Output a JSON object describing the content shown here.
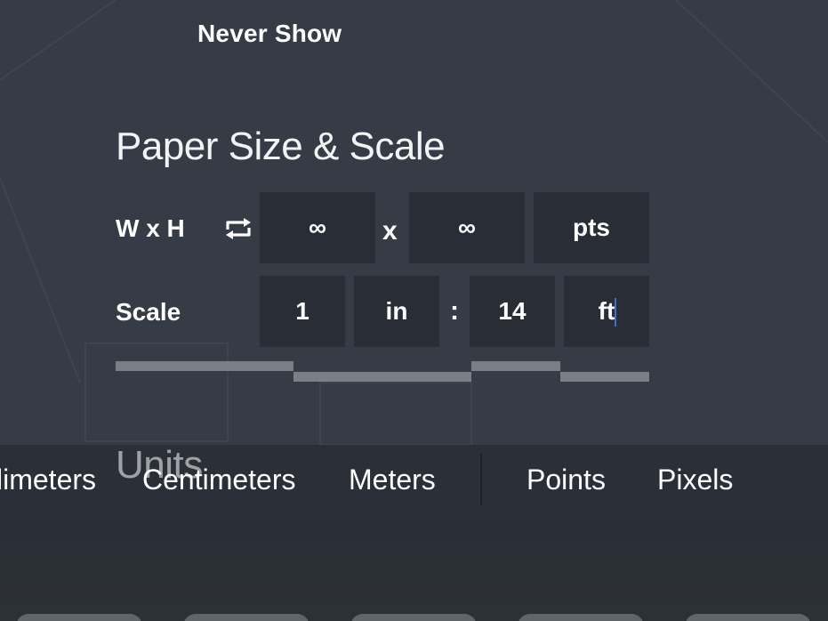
{
  "header": {
    "never_show": "Never Show"
  },
  "paper": {
    "title": "Paper Size & Scale",
    "size_label": "W x H",
    "width_value": "∞",
    "times_sign": "x",
    "height_value": "∞",
    "size_unit": "pts",
    "scale_label": "Scale",
    "scale_paper_value": "1",
    "scale_paper_unit": "in",
    "ratio_sign": ":",
    "scale_real_value": "14",
    "scale_real_unit": "ft"
  },
  "units": {
    "title": "Units",
    "options": [
      "limeters",
      "Centimeters",
      "Meters",
      "Points",
      "Pixels"
    ]
  },
  "colors": {
    "background": "#363c46",
    "field": "#282d36",
    "units_band": "#2b3038",
    "caret": "#3b6fd6"
  }
}
